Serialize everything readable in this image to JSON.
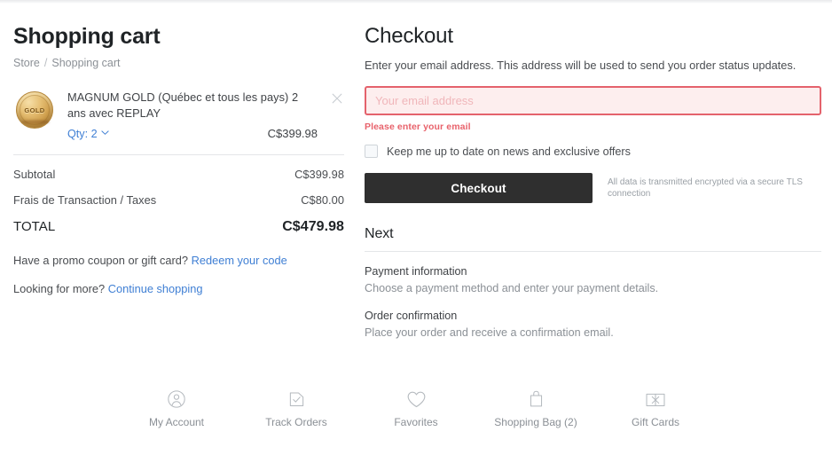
{
  "cart": {
    "title": "Shopping cart",
    "breadcrumb": {
      "root": "Store",
      "separator": "/",
      "current": "Shopping cart"
    },
    "item": {
      "name": "MAGNUM GOLD (Québec et tous les pays) 2 ans avec REPLAY",
      "thumb_text": "GOLD",
      "qty_label": "Qty: 2",
      "price": "C$399.98",
      "remove_icon": "close-icon"
    },
    "totals": [
      {
        "label": "Subtotal",
        "value": "C$399.98"
      },
      {
        "label": "Frais de Transaction / Taxes",
        "value": "C$80.00"
      }
    ],
    "grand_total": {
      "label": "TOTAL",
      "value": "C$479.98"
    },
    "promo": {
      "text": "Have a promo coupon or gift card?",
      "link": "Redeem your code"
    },
    "more": {
      "text": "Looking for more?",
      "link": "Continue shopping"
    }
  },
  "checkout": {
    "title": "Checkout",
    "subtitle": "Enter your email address. This address will be used to send you order status updates.",
    "email": {
      "value": "",
      "placeholder": "Your email address"
    },
    "error": "Please enter your email",
    "optin": {
      "label": "Keep me up to date on news and exclusive offers",
      "checked": false
    },
    "button": "Checkout",
    "security_note": "All data is transmitted encrypted via a secure TLS connection",
    "next_heading": "Next",
    "steps": [
      {
        "title": "Payment information",
        "desc": "Choose a payment method and enter your payment details."
      },
      {
        "title": "Order confirmation",
        "desc": "Place your order and receive a confirmation email."
      }
    ]
  },
  "bottom_nav": [
    {
      "label": "My Account",
      "icon": "user-circle-icon"
    },
    {
      "label": "Track Orders",
      "icon": "document-check-icon"
    },
    {
      "label": "Favorites",
      "icon": "heart-icon"
    },
    {
      "label": "Shopping Bag (2)",
      "icon": "shopping-bag-icon"
    },
    {
      "label": "Gift Cards",
      "icon": "gift-card-icon"
    }
  ],
  "colors": {
    "link": "#3f7fd4",
    "error": "#e8626b",
    "error_border": "#e4626c",
    "error_bg": "#fdeeee",
    "button": "#2f2f2f",
    "text": "#3f4246",
    "muted": "#8b9096"
  }
}
